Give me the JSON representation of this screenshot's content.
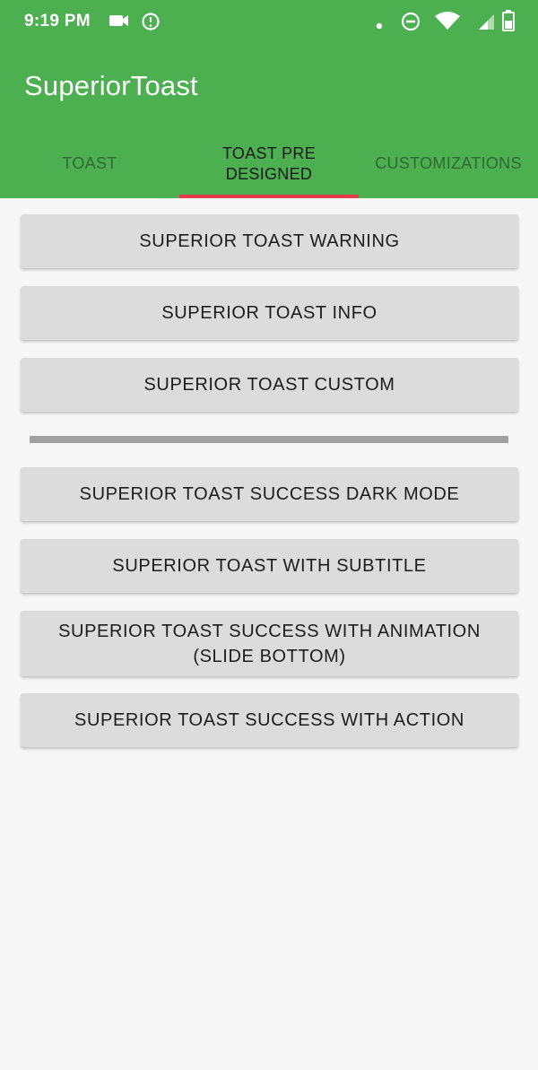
{
  "status_bar": {
    "time": "9:19 PM",
    "left_icons": [
      "video-camera-icon",
      "alarm-icon"
    ],
    "right_icons": [
      "dot-icon",
      "do-not-disturb-icon",
      "wifi-icon",
      "signal-icon",
      "battery-icon"
    ]
  },
  "app": {
    "title": "SuperiorToast",
    "colors": {
      "primary": "#4caf50",
      "tab_indicator": "#e53950",
      "button": "#dcdcdc",
      "background": "#f7f7f8"
    }
  },
  "tabs": [
    {
      "label": "TOAST",
      "active": false
    },
    {
      "label": "TOAST PRE DESIGNED",
      "active": true
    },
    {
      "label": "CUSTOMIZATIONS",
      "active": false
    }
  ],
  "buttons": [
    {
      "label": "SUPERIOR TOAST WARNING"
    },
    {
      "label": "SUPERIOR TOAST INFO"
    },
    {
      "label": "SUPERIOR TOAST CUSTOM"
    },
    {
      "label": "SUPERIOR TOAST SUCCESS DARK MODE"
    },
    {
      "label": "SUPERIOR TOAST WITH SUBTITLE"
    },
    {
      "label": "SUPERIOR TOAST SUCCESS WITH ANIMATION (SLIDE BOTTOM)"
    },
    {
      "label": "SUPERIOR TOAST SUCCESS WITH ACTION"
    }
  ]
}
